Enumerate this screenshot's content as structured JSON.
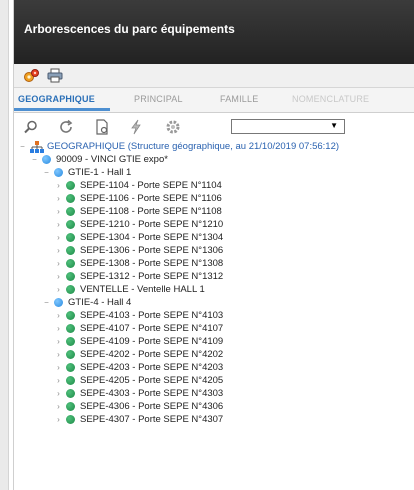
{
  "window": {
    "title": "Arborescences du parc équipements"
  },
  "toolbar": {
    "buttons": [
      {
        "icon": "gears-icon"
      },
      {
        "icon": "print-icon"
      }
    ]
  },
  "tabs": [
    {
      "label": "GEOGRAPHIQUE",
      "active": true
    },
    {
      "label": "PRINCIPAL",
      "active": false
    },
    {
      "label": "FAMILLE",
      "active": false
    },
    {
      "label": "NOMENCLATURE",
      "active": false
    }
  ],
  "tools": {
    "icons": [
      "search-icon",
      "refresh-icon",
      "document-icon",
      "lightning-icon",
      "settings-icon"
    ],
    "filter_value": ""
  },
  "tree": {
    "root": "GEOGRAPHIQUE (Structure géographique, au 21/10/2019 07:56:12)",
    "site": "90009 - VINCI GTIE expo*",
    "groups": [
      {
        "label": "GTIE-1 - Hall 1",
        "items": [
          "SEPE-1104 - Porte SEPE N°1104",
          "SEPE-1106 - Porte SEPE N°1106",
          "SEPE-1108 - Porte SEPE N°1108",
          "SEPE-1210 - Porte SEPE N°1210",
          "SEPE-1304 - Porte SEPE N°1304",
          "SEPE-1306 - Porte SEPE N°1306",
          "SEPE-1308 - Porte SEPE N°1308",
          "SEPE-1312 - Porte SEPE N°1312",
          "VENTELLE - Ventelle HALL 1"
        ]
      },
      {
        "label": "GTIE-4 - Hall 4",
        "items": [
          "SEPE-4103 - Porte SEPE N°4103",
          "SEPE-4107 - Porte SEPE N°4107",
          "SEPE-4109 - Porte SEPE N°4109",
          "SEPE-4202 - Porte SEPE N°4202",
          "SEPE-4203 - Porte SEPE N°4203",
          "SEPE-4205 - Porte SEPE N°4205",
          "SEPE-4303 - Porte SEPE N°4303",
          "SEPE-4306 - Porte SEPE N°4306",
          "SEPE-4307 - Porte SEPE N°4307"
        ]
      }
    ]
  },
  "colors": {
    "title_bar": "#2e2e2e",
    "tab_active": "#2a6fb7",
    "node_green": "#2e9e5a",
    "node_blue": "#3a9be8",
    "root_text": "#2a62b0"
  }
}
